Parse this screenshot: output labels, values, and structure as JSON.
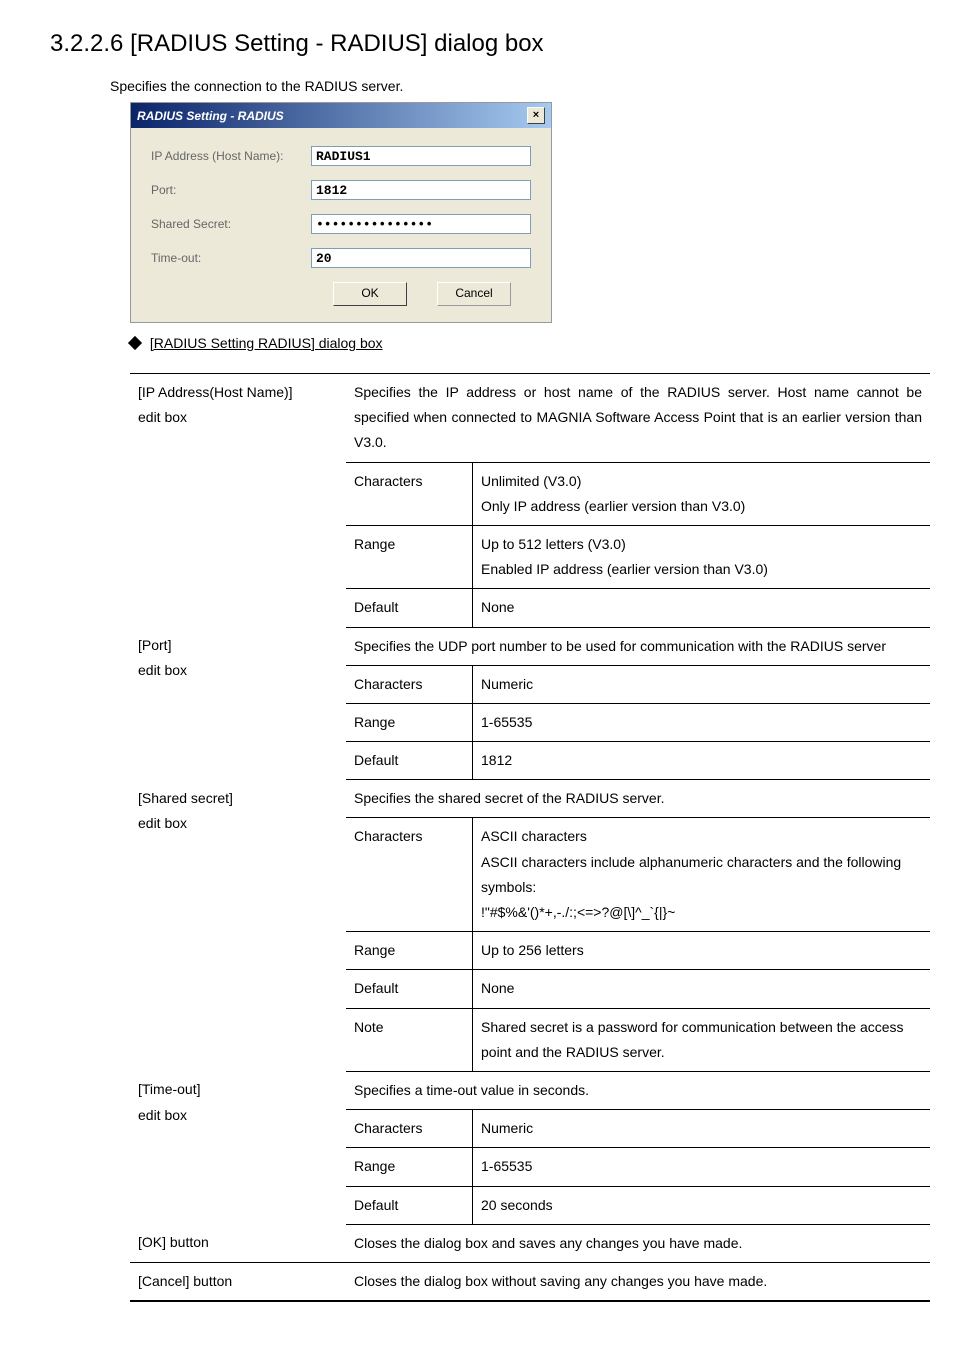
{
  "section_title": "3.2.2.6 [RADIUS Setting - RADIUS] dialog box",
  "intro": "Specifies the connection to the RADIUS server.",
  "dialog": {
    "title": "RADIUS Setting - RADIUS",
    "close": "×",
    "rows": {
      "ip_label": "IP Address (Host Name):",
      "ip_value": "RADIUS1",
      "port_label": "Port:",
      "port_value": "1812",
      "secret_label": "Shared Secret:",
      "secret_value": "***************",
      "timeout_label": "Time-out:",
      "timeout_value": "20"
    },
    "ok": "OK",
    "cancel": "Cancel"
  },
  "caption": "[RADIUS Setting RADIUS] dialog box",
  "rows": {
    "ip": {
      "name": "[IP Address(Host Name)]\nedit box",
      "desc": "Specifies the IP address or host name of the RADIUS server. Host name cannot be specified when connected to MAGNIA Software Access Point that is an earlier version than V3.0.",
      "chars_label": "Characters",
      "chars_val": "Unlimited (V3.0)\nOnly IP address (earlier version than V3.0)",
      "range_label": "Range",
      "range_val": "Up to 512 letters (V3.0)\nEnabled IP address (earlier version than V3.0)",
      "default_label": "Default",
      "default_val": "None"
    },
    "port": {
      "name": "[Port]\nedit box",
      "desc": "Specifies the UDP port number to be used for communication with the RADIUS server",
      "chars_label": "Characters",
      "chars_val": "Numeric",
      "range_label": "Range",
      "range_val": "1-65535",
      "default_label": "Default",
      "default_val": "1812"
    },
    "secret": {
      "name": "[Shared secret]\nedit box",
      "desc": "Specifies the shared secret of the RADIUS server.",
      "chars_label": "Characters",
      "chars_val": "ASCII characters\nASCII characters include alphanumeric characters and the following symbols:\n!\"#$%&'()*+,-./:;<=>?@[\\]^_`{|}~",
      "range_label": "Range",
      "range_val": "Up to 256 letters",
      "default_label": "Default",
      "default_val": "None",
      "note_label": "Note",
      "note_val": "Shared secret is a password for communication between the access point and the RADIUS server."
    },
    "timeout": {
      "name": "[Time-out]\nedit box",
      "desc": "Specifies a time-out value in seconds.",
      "chars_label": "Characters",
      "chars_val": "Numeric",
      "range_label": "Range",
      "range_val": "1-65535",
      "default_label": "Default",
      "default_val": "20 seconds"
    },
    "ok": {
      "name": "[OK] button",
      "desc": "Closes the dialog box and saves any changes you have made."
    },
    "cancel": {
      "name": "[Cancel] button",
      "desc": "Closes the dialog box without saving any changes you have made."
    }
  }
}
